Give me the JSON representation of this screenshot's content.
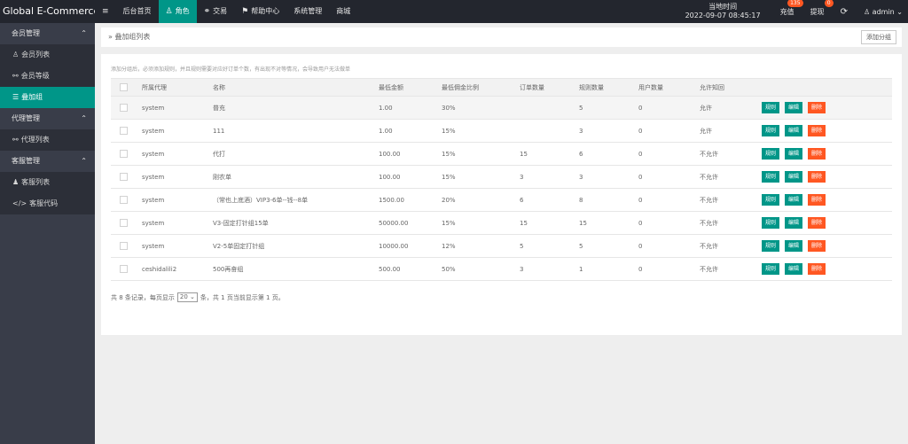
{
  "app": {
    "title": "Global E-Commerce..."
  },
  "nav": [
    {
      "icon": "≡",
      "label": ""
    },
    {
      "icon": "",
      "label": "后台首页"
    },
    {
      "icon": "♙",
      "label": "角色"
    },
    {
      "icon": "⚭",
      "label": "交易"
    },
    {
      "icon": "⚑",
      "label": "帮助中心"
    },
    {
      "icon": "",
      "label": "系统管理"
    },
    {
      "icon": "",
      "label": "商城"
    }
  ],
  "header": {
    "clock_label": "当地时间",
    "clock_value": "2022-09-07 08:45:17",
    "recharge_label": "充值",
    "recharge_badge": "135",
    "withdraw_label": "提现",
    "withdraw_badge": "0",
    "user": "admin"
  },
  "sidebar": {
    "groups": [
      {
        "label": "会员管理",
        "items": [
          {
            "icon": "♙",
            "label": "会员列表"
          },
          {
            "icon": "⚯",
            "label": "会员等级"
          },
          {
            "icon": "☰",
            "label": "叠加组"
          }
        ]
      },
      {
        "label": "代理管理",
        "items": [
          {
            "icon": "⚯",
            "label": "代理列表"
          }
        ]
      },
      {
        "label": "客服管理",
        "items": [
          {
            "icon": "♟",
            "label": "客服列表"
          },
          {
            "icon": "</>",
            "label": "客服代码"
          }
        ]
      }
    ]
  },
  "breadcrumb": "叠加组列表",
  "add_button": "添加分组",
  "hint": "添加分组后，必须添加规则，并且规则需要对应好订单个数，有出现不对等情况，会导致用户无法做单",
  "table": {
    "headers": [
      "所属代理",
      "名称",
      "最低金额",
      "最低佣金比例",
      "订单数量",
      "规则数量",
      "用户数量",
      "允许知回"
    ],
    "rows": [
      [
        "system",
        "普充",
        "1.00",
        "30%",
        "",
        "5",
        "0",
        "允许"
      ],
      [
        "system",
        "111",
        "1.00",
        "15%",
        "",
        "3",
        "0",
        "允许"
      ],
      [
        "system",
        "代打",
        "100.00",
        "15%",
        "15",
        "6",
        "0",
        "不允许"
      ],
      [
        "system",
        "刚农单",
        "100.00",
        "15%",
        "3",
        "3",
        "0",
        "不允许"
      ],
      [
        "system",
        "（常也上底酒）VIP3-6单--钱--8单",
        "1500.00",
        "20%",
        "6",
        "8",
        "0",
        "不允许"
      ],
      [
        "system",
        "V3-固定打针组15单",
        "50000.00",
        "15%",
        "15",
        "15",
        "0",
        "不允许"
      ],
      [
        "system",
        "V2-5单固定打针组",
        "10000.00",
        "12%",
        "5",
        "5",
        "0",
        "不允许"
      ],
      [
        "ceshidalili2",
        "500再奋组",
        "500.00",
        "50%",
        "3",
        "1",
        "0",
        "不允许"
      ]
    ],
    "ops": [
      "规则",
      "编辑",
      "删除"
    ]
  },
  "pager": {
    "prefix": "共 8 条记录，每页显示",
    "size": "20",
    "suffix": "条，共 1 页当前显示第 1 页。"
  },
  "colors": {
    "accent": "#009688",
    "danger": "#ff5722",
    "topbar": "#23262e",
    "sidebar": "#393d49"
  }
}
